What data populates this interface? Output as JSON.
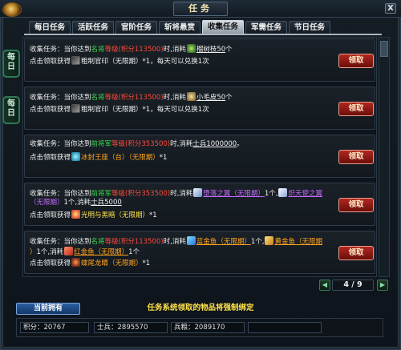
{
  "window": {
    "title": "任务",
    "close_label": "X"
  },
  "tabs": [
    {
      "label": "每日任务"
    },
    {
      "label": "活跃任务"
    },
    {
      "label": "官阶任务"
    },
    {
      "label": "斩将悬赏"
    },
    {
      "label": "收集任务",
      "active": true
    },
    {
      "label": "军需任务"
    },
    {
      "label": "节日任务"
    }
  ],
  "side_tabs": [
    {
      "label": "每日"
    },
    {
      "label": "每日"
    }
  ],
  "entries": [
    {
      "l1": {
        "a": "收集任务：当你达到",
        "b": "名将",
        "c": "等级",
        "d": "(积分113500)",
        "e": "时,消耗",
        "f": "榴树枝50",
        "g": "个"
      },
      "l2": {
        "a": "点击领取获得",
        "b": "粗制官印（无限期）",
        "c": "*1，每天可以兑换1次"
      }
    },
    {
      "l1": {
        "a": "收集任务：当你达到",
        "b": "名将",
        "c": "等级",
        "d": "(积分113500)",
        "e": "时,消耗",
        "f": "小毛皮50",
        "g": "个"
      },
      "l2": {
        "a": "点击领取获得",
        "b": "粗制官印（无限期）",
        "c": "*1，每天可以兑换1次"
      }
    },
    {
      "l1": {
        "a": "收集任务：当你达到",
        "b": "前将军",
        "c": "等级",
        "d": "(积分353500)",
        "e": "时,消耗",
        "f": "士兵1000000",
        "g": "。"
      },
      "l2": {
        "a": "点击领取获得",
        "b": "冰封王座（台）（无限期）",
        "c": "*1"
      }
    },
    {
      "l1": {
        "a": "收集任务：当你达到",
        "b": "前将军",
        "c": "等级",
        "d": "(积分353500)",
        "e": "时,消耗",
        "f": "堕落之翼（无限期）",
        "g": "1个,",
        "h": "炽天使之翼"
      },
      "l2": {
        "a": "（无限期）",
        "b": "1个,消耗",
        "c": "士兵5000"
      },
      "l3": {
        "a": "点击领取获得",
        "b": "光明与黑暗（无限期）",
        "c": "*1"
      }
    },
    {
      "l1": {
        "a": "收集任务：当你达到",
        "b": "名将",
        "c": "等级",
        "d": "(积分113500)",
        "e": "时,消耗",
        "f": "蓝金鱼（无限期）",
        "g": "1个,",
        "h": "黄金鱼（无限期"
      },
      "l2": {
        "a": "）",
        "b": "1个,消耗",
        "c": "红金鱼（无限期）",
        "d": "1个"
      },
      "l3": {
        "a": "点击领取获得",
        "b": "蝶尾龙睛（无限期）",
        "c": "*1"
      }
    }
  ],
  "claim_label": "领取",
  "pager": {
    "current": "4",
    "sep": "/",
    "total": "9",
    "prev": "◀",
    "next": "▶"
  },
  "footer": {
    "owned_button": "当前拥有",
    "notice": "任务系统领取的物品将强制绑定",
    "stats": [
      {
        "label": "积分：",
        "value": "20767"
      },
      {
        "label": "士兵：",
        "value": "2895570"
      },
      {
        "label": "兵粮：",
        "value": "2089170"
      },
      {
        "label": "",
        "value": ""
      }
    ]
  }
}
